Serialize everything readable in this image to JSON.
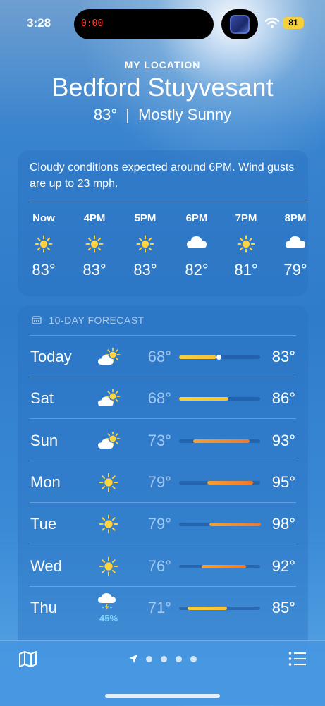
{
  "status_bar": {
    "time": "3:28",
    "timer": "0:00",
    "battery": "81"
  },
  "header": {
    "label": "MY LOCATION",
    "location": "Bedford Stuyvesant",
    "temp": "83°",
    "separator": "|",
    "condition": "Mostly Sunny"
  },
  "hourly": {
    "summary": "Cloudy conditions expected around 6PM. Wind gusts are up to 23 mph.",
    "items": [
      {
        "label": "Now",
        "icon": "sun-icon",
        "temp": "83°"
      },
      {
        "label": "4PM",
        "icon": "sun-icon",
        "temp": "83°"
      },
      {
        "label": "5PM",
        "icon": "sun-icon",
        "temp": "83°"
      },
      {
        "label": "6PM",
        "icon": "cloud-icon",
        "temp": "82°"
      },
      {
        "label": "7PM",
        "icon": "sun-icon",
        "temp": "81°"
      },
      {
        "label": "8PM",
        "icon": "cloud-icon",
        "temp": "79°"
      }
    ]
  },
  "forecast": {
    "title": "10-DAY FORECAST",
    "days": [
      {
        "day": "Today",
        "icon": "partly-cloudy-icon",
        "low": "68°",
        "high": "83°",
        "precip": ""
      },
      {
        "day": "Sat",
        "icon": "partly-cloudy-icon",
        "low": "68°",
        "high": "86°",
        "precip": ""
      },
      {
        "day": "Sun",
        "icon": "partly-cloudy-icon",
        "low": "73°",
        "high": "93°",
        "precip": ""
      },
      {
        "day": "Mon",
        "icon": "sun-icon",
        "low": "79°",
        "high": "95°",
        "precip": ""
      },
      {
        "day": "Tue",
        "icon": "sun-icon",
        "low": "79°",
        "high": "98°",
        "precip": ""
      },
      {
        "day": "Wed",
        "icon": "sun-icon",
        "low": "76°",
        "high": "92°",
        "precip": ""
      },
      {
        "day": "Thu",
        "icon": "thunderstorm-icon",
        "low": "71°",
        "high": "85°",
        "precip": "45%"
      }
    ]
  },
  "bottom_bar": {
    "icons": [
      "map-icon",
      "location-arrow-icon",
      "list-icon"
    ],
    "page_dots": 4
  },
  "colors": {
    "sun": "#ffd23f",
    "range_cool": "#f4d03f",
    "range_warm": "#f0782a",
    "precip": "#7fd3ff"
  }
}
